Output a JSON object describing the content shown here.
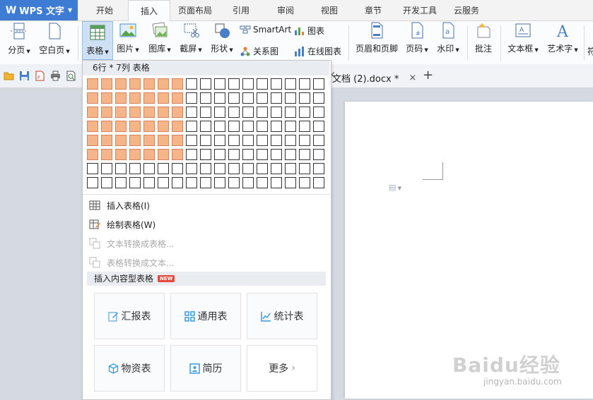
{
  "app": {
    "name": "WPS 文字"
  },
  "tabs": [
    "开始",
    "插入",
    "页面布局",
    "引用",
    "审阅",
    "视图",
    "章节",
    "开发工具",
    "云服务"
  ],
  "active_tab": "插入",
  "ribbon": {
    "page_break": "分页",
    "blank_page": "空白页",
    "table": "表格",
    "picture": "图片",
    "gallery": "图库",
    "screenshot": "截屏",
    "shape": "形状",
    "smartart": "SmartArt",
    "chart": "图表",
    "relation": "关系图",
    "online_chart": "在线图表",
    "header_footer": "页眉和页脚",
    "page_number": "页码",
    "watermark": "水印",
    "comment": "批注",
    "textbox": "文本框",
    "wordart": "艺术字",
    "symbol_partial": "符"
  },
  "doc_tab": {
    "title": "文档 (2).docx *",
    "close": "×",
    "new": "+"
  },
  "table_menu": {
    "header": "6行 * 7列 表格",
    "grid": {
      "rows": 8,
      "cols": 17,
      "selected_rows": 6,
      "selected_cols": 7
    },
    "items": [
      {
        "label": "插入表格(I)",
        "enabled": true
      },
      {
        "label": "绘制表格(W)",
        "enabled": true
      },
      {
        "label": "文本转换成表格...",
        "enabled": false
      },
      {
        "label": "表格转换成文本...",
        "enabled": false
      }
    ],
    "content_table_header": "插入内容型表格",
    "new_badge": "NEW",
    "cards": [
      "汇报表",
      "通用表",
      "统计表",
      "物资表",
      "简历",
      "更多"
    ]
  },
  "watermark": {
    "logo": "Baidu经验",
    "url": "jingyan.baidu.com"
  },
  "colors": {
    "accent": "#3e7bd3",
    "selected_cell": "#f5b589",
    "ribbon_bg": "#fbfcfe"
  }
}
